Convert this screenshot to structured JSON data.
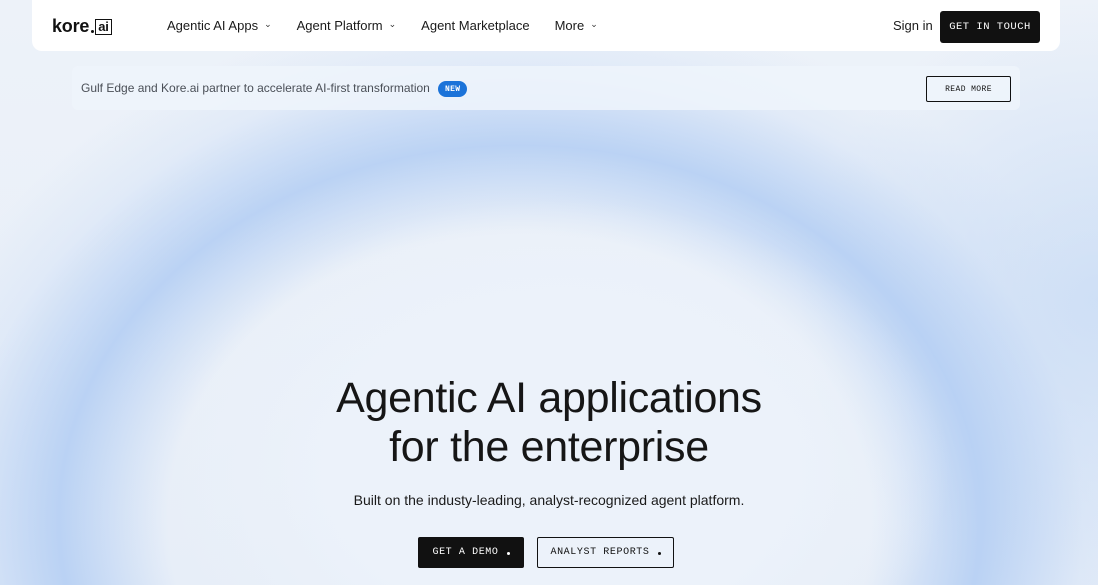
{
  "brand": {
    "name": "kore",
    "suffix": "ai"
  },
  "nav": {
    "items": [
      {
        "label": "Agentic AI Apps",
        "has_dropdown": true,
        "icon": "chevron-down-icon"
      },
      {
        "label": "Agent Platform",
        "has_dropdown": true,
        "icon": "chevron-down-icon"
      },
      {
        "label": "Agent Marketplace",
        "has_dropdown": false
      },
      {
        "label": "More",
        "has_dropdown": true,
        "icon": "chevron-down-icon"
      }
    ],
    "sign_in": "Sign in",
    "cta": "GET IN TOUCH"
  },
  "announcement": {
    "text": "Gulf Edge and Kore.ai partner to accelerate AI-first transformation",
    "badge": "NEW",
    "cta": "READ MORE"
  },
  "hero": {
    "title_line1": "Agentic AI applications",
    "title_line2": "for the enterprise",
    "subtitle": "Built on the industy-leading, analyst-recognized agent platform.",
    "primary_cta": "GET A DEMO",
    "secondary_cta": "ANALYST REPORTS"
  },
  "colors": {
    "primary_button": "#111111",
    "badge": "#1b73d9",
    "background": "#e9f0f9"
  }
}
